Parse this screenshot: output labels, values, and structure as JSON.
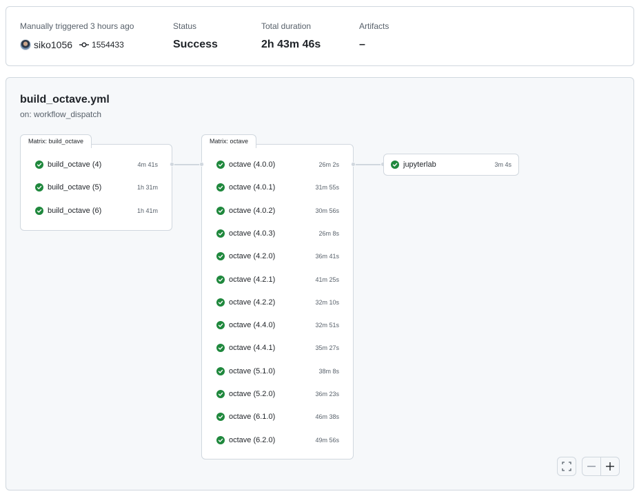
{
  "summary": {
    "trigger_label": "Manually triggered 3 hours ago",
    "actor": "siko1056",
    "commit_sha": "1554433",
    "status_label": "Status",
    "status_value": "Success",
    "duration_label": "Total duration",
    "duration_value": "2h 43m 46s",
    "artifacts_label": "Artifacts",
    "artifacts_value": "–"
  },
  "workflow": {
    "file": "build_octave.yml",
    "trigger": "on: workflow_dispatch"
  },
  "matrices": [
    {
      "label": "Matrix: build_octave",
      "jobs": [
        {
          "name": "build_octave (4)",
          "duration": "4m 41s",
          "status": "success"
        },
        {
          "name": "build_octave (5)",
          "duration": "1h 31m",
          "status": "success"
        },
        {
          "name": "build_octave (6)",
          "duration": "1h 41m",
          "status": "success"
        }
      ]
    },
    {
      "label": "Matrix: octave",
      "jobs": [
        {
          "name": "octave (4.0.0)",
          "duration": "26m 2s",
          "status": "success"
        },
        {
          "name": "octave (4.0.1)",
          "duration": "31m 55s",
          "status": "success"
        },
        {
          "name": "octave (4.0.2)",
          "duration": "30m 56s",
          "status": "success"
        },
        {
          "name": "octave (4.0.3)",
          "duration": "26m 8s",
          "status": "success"
        },
        {
          "name": "octave (4.2.0)",
          "duration": "36m 41s",
          "status": "success"
        },
        {
          "name": "octave (4.2.1)",
          "duration": "41m 25s",
          "status": "success"
        },
        {
          "name": "octave (4.2.2)",
          "duration": "32m 10s",
          "status": "success"
        },
        {
          "name": "octave (4.4.0)",
          "duration": "32m 51s",
          "status": "success"
        },
        {
          "name": "octave (4.4.1)",
          "duration": "35m 27s",
          "status": "success"
        },
        {
          "name": "octave (5.1.0)",
          "duration": "38m 8s",
          "status": "success"
        },
        {
          "name": "octave (5.2.0)",
          "duration": "36m 23s",
          "status": "success"
        },
        {
          "name": "octave (6.1.0)",
          "duration": "46m 38s",
          "status": "success"
        },
        {
          "name": "octave (6.2.0)",
          "duration": "49m 56s",
          "status": "success"
        }
      ]
    }
  ],
  "single_job": {
    "name": "jupyterlab",
    "duration": "3m 4s",
    "status": "success"
  },
  "controls": {
    "fullscreen_icon": "fullscreen-icon",
    "zoom_out_icon": "minus-icon",
    "zoom_in_icon": "plus-icon"
  },
  "colors": {
    "success": "#1f883d"
  }
}
